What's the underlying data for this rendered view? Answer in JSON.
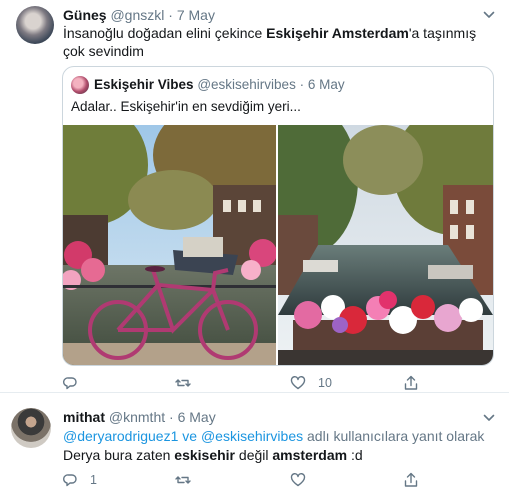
{
  "tweet1": {
    "name": "Güneş",
    "handle": "@gnszkl",
    "separator": "·",
    "date": "7 May",
    "text_1": "İnsanoğlu doğadan elini çekince ",
    "text_bold": "Eskişehir Amsterdam",
    "text_2": "'a taşınmış çok sevindim",
    "quote": {
      "name": "Eskişehir Vibes",
      "handle": "@eskisehirvibes",
      "separator": "·",
      "date": "6 May",
      "text": "Adalar.. Eskişehir'in en sevdiğim yeri..."
    },
    "actions": {
      "reply_count": "",
      "retweet_count": "",
      "like_count": "10",
      "icons": [
        "reply-icon",
        "retweet-icon",
        "heart-icon",
        "share-icon"
      ]
    }
  },
  "tweet2": {
    "name": "mithat",
    "handle": "@knmtht",
    "separator": "·",
    "date": "6 May",
    "mention_1": "@deryarodriguez1",
    "connector": " ve ",
    "mention_2": "@eskisehirvibes",
    "reply_suffix": " adlı kullanıcılara yanıt olarak",
    "text_1": "Derya bura zaten ",
    "bold_1": "eskisehir",
    "text_2": " değil ",
    "bold_2": "amsterdam",
    "text_3": " :d",
    "actions": {
      "reply_count": "1",
      "icons": [
        "reply-icon",
        "retweet-icon",
        "heart-icon",
        "share-icon"
      ]
    }
  },
  "colors": {
    "link": "#1b95e0",
    "muted": "#657786",
    "text": "#14171a",
    "border": "#ccd6dd"
  }
}
